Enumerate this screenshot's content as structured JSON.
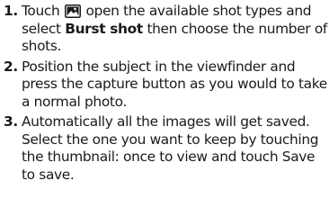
{
  "steps": [
    {
      "number": "1",
      "pre_icon": "Touch",
      "icon": "shot-mode-icon",
      "post_icon": "open the available shot types and select",
      "bold": "Burst shot",
      "post_bold": "then choose the number of shots."
    },
    {
      "number": "2",
      "text": "Position the subject in the viewfinder and press the capture button as you would to take a normal photo."
    },
    {
      "number": "3",
      "text": "Automatically all the images will get saved. Select the one you want to keep by touching the thumbnail: once to view and touch Save to save."
    }
  ]
}
